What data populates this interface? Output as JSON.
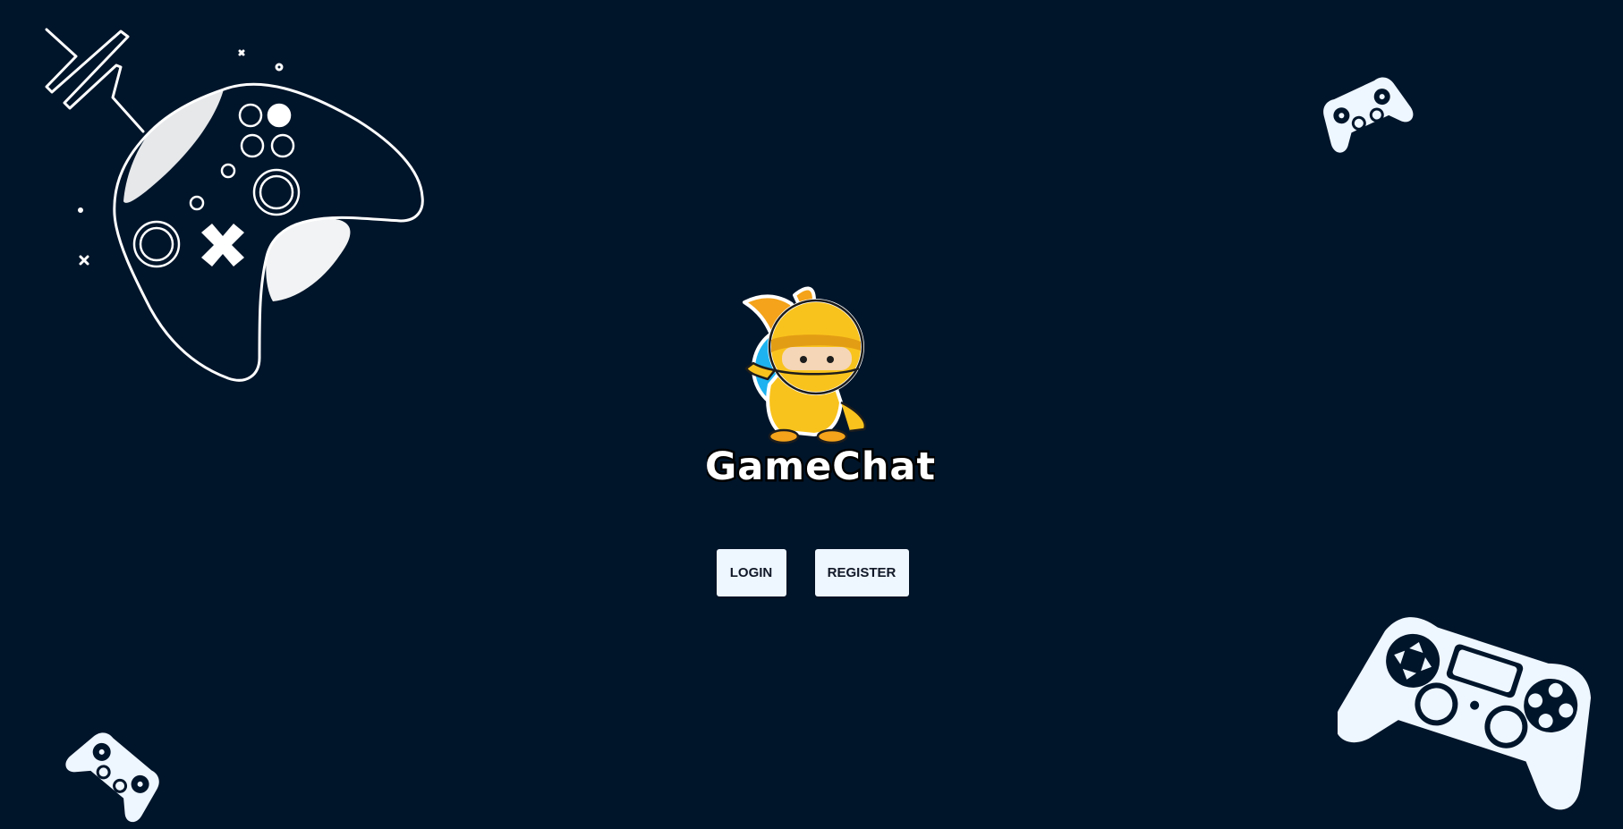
{
  "app": {
    "name": "GameChat"
  },
  "actions": {
    "login_label": "LOGIN",
    "register_label": "REGISTER"
  },
  "theme": {
    "background": "#00152a",
    "button_bg": "#eef6ff",
    "button_text": "#111827",
    "mascot_primary": "#f9c31d",
    "mascot_accent": "#1eb3f0",
    "outline": "#ffffff"
  },
  "icons": {
    "top_left": "xbox-controller-icon",
    "top_right": "playstation-controller-icon",
    "bottom_right": "playstation-controller-icon",
    "bottom_left": "playstation-controller-icon",
    "logo": "ninja-mascot-icon"
  }
}
